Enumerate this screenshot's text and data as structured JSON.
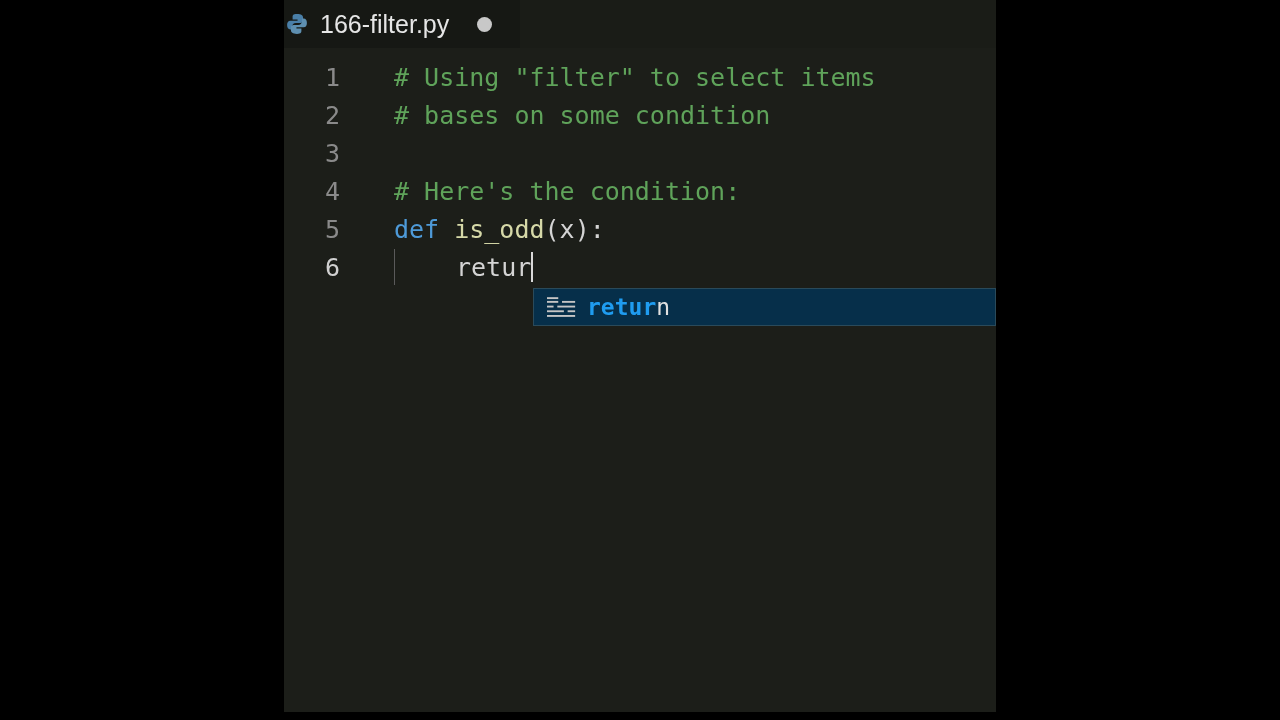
{
  "tab": {
    "filename": "166-filter.py",
    "unsaved": true
  },
  "lines": [
    {
      "number": "1",
      "tokens": [
        {
          "kind": "comment",
          "text": "# Using \"filter\" to select items"
        }
      ]
    },
    {
      "number": "2",
      "tokens": [
        {
          "kind": "comment",
          "text": "# bases on some condition"
        }
      ]
    },
    {
      "number": "3"
    },
    {
      "number": "4",
      "tokens": [
        {
          "kind": "comment",
          "text": "# Here's the condition:"
        }
      ]
    },
    {
      "number": "5",
      "tokens": [
        {
          "kind": "keyword",
          "text": "def"
        },
        {
          "kind": "function",
          "text": "is_odd"
        },
        {
          "kind": "plain",
          "text": "(x):"
        }
      ]
    },
    {
      "number": "6",
      "indented": true,
      "cursor": true,
      "tokens": [
        {
          "kind": "plain",
          "text": "retur"
        }
      ]
    }
  ],
  "suggestion": {
    "matched": "retur",
    "rest": "n",
    "selected": true
  }
}
